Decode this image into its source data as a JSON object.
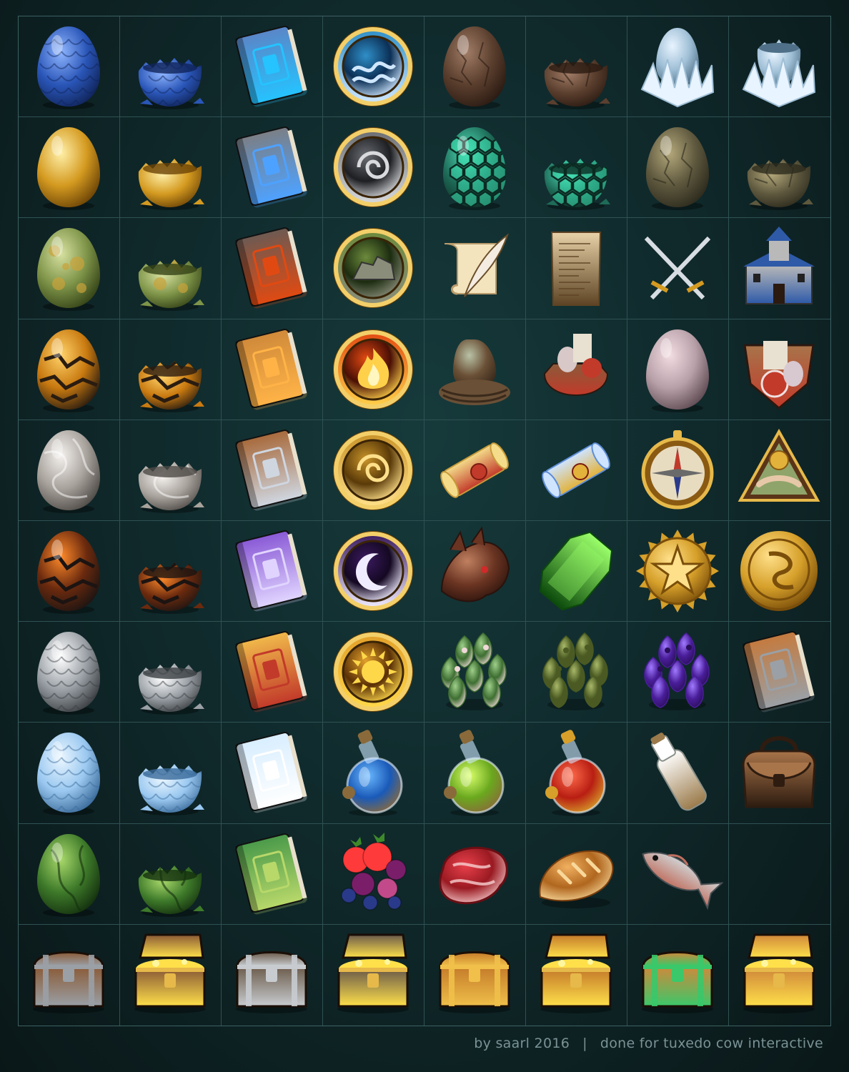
{
  "credit": {
    "author": "by saarl 2016",
    "separator": "|",
    "client": "done for tuxedo cow interactive"
  },
  "colors": {
    "background": "#102a2c",
    "grid_line": "#2f5153",
    "credit_text": "#7a9395"
  },
  "grid": {
    "columns": 8,
    "rows": 10,
    "icons": [
      {
        "icon": "egg",
        "c1": "#8fb6ff",
        "c2": "#2a56b8",
        "c3": "#10245a",
        "mark": "scale"
      },
      {
        "icon": "egg-hatched",
        "c1": "#8fb6ff",
        "c2": "#2a56b8",
        "c3": "#10245a",
        "mark": "scale"
      },
      {
        "icon": "book",
        "c1": "#5a86c8",
        "c2": "#243f78",
        "c3": "#25c3ff"
      },
      {
        "icon": "medallion",
        "c1": "#2f8fc8",
        "c2": "#0b2f55",
        "c3": "#cfe7ff",
        "sym": "wave"
      },
      {
        "icon": "egg",
        "c1": "#a07c66",
        "c2": "#5b3f2e",
        "c3": "#2a1a12",
        "mark": "crack"
      },
      {
        "icon": "egg-hatched",
        "c1": "#a07c66",
        "c2": "#5b3f2e",
        "c3": "#2a1a12",
        "mark": "crack"
      },
      {
        "icon": "egg-crystal",
        "c1": "#e8f4ff",
        "c2": "#9fbfd6",
        "c3": "#4f7088"
      },
      {
        "icon": "egg-crystal-hatched",
        "c1": "#e8f4ff",
        "c2": "#9fbfd6",
        "c3": "#4f7088"
      },
      {
        "icon": "egg",
        "c1": "#fff0a8",
        "c2": "#d49a20",
        "c3": "#6b4306",
        "mark": "none"
      },
      {
        "icon": "egg-hatched",
        "c1": "#fff0a8",
        "c2": "#d49a20",
        "c3": "#6b4306",
        "mark": "none"
      },
      {
        "icon": "book",
        "c1": "#7b7f86",
        "c2": "#35383d",
        "c3": "#4ea2ff"
      },
      {
        "icon": "medallion",
        "c1": "#6a6d72",
        "c2": "#1d1f23",
        "c3": "#d8dadd",
        "sym": "swirl"
      },
      {
        "icon": "egg",
        "c1": "#4fe0b8",
        "c2": "#1e6b58",
        "c3": "#0b2a22",
        "mark": "hex"
      },
      {
        "icon": "egg-hatched",
        "c1": "#4fe0b8",
        "c2": "#1e6b58",
        "c3": "#0b2a22",
        "mark": "hex"
      },
      {
        "icon": "egg",
        "c1": "#b3a77a",
        "c2": "#5e583e",
        "c3": "#2c2a1d",
        "mark": "crack"
      },
      {
        "icon": "egg-hatched",
        "c1": "#b3a77a",
        "c2": "#5e583e",
        "c3": "#2c2a1d",
        "mark": "crack"
      },
      {
        "icon": "egg",
        "c1": "#d7e1a0",
        "c2": "#7e9448",
        "c3": "#344217",
        "mark": "spot"
      },
      {
        "icon": "egg-hatched",
        "c1": "#d7e1a0",
        "c2": "#7e9448",
        "c3": "#344217",
        "mark": "spot"
      },
      {
        "icon": "book",
        "c1": "#6d5a52",
        "c2": "#2e2420",
        "c3": "#e04a12"
      },
      {
        "icon": "medallion",
        "c1": "#6c8a3c",
        "c2": "#1c2c10",
        "c3": "#8a8d7a",
        "sym": "rock"
      },
      {
        "icon": "scroll-quill",
        "c1": "#f3e4be",
        "c2": "#b89a6a",
        "c3": "#6b4e2a"
      },
      {
        "icon": "parchment",
        "c1": "#e8d2a8",
        "c2": "#a68454",
        "c3": "#5e4424"
      },
      {
        "icon": "swords",
        "c1": "#d7dde2",
        "c2": "#7c8590",
        "c3": "#d49a20"
      },
      {
        "icon": "castle",
        "c1": "#b9b9b9",
        "c2": "#5a5a62",
        "c3": "#2e5aa8"
      },
      {
        "icon": "egg",
        "c1": "#ffd36a",
        "c2": "#c97a10",
        "c3": "#2a1c10",
        "mark": "lava"
      },
      {
        "icon": "egg-hatched",
        "c1": "#ffd36a",
        "c2": "#c97a10",
        "c3": "#2a1c10",
        "mark": "lava"
      },
      {
        "icon": "book",
        "c1": "#d08a3a",
        "c2": "#6e3b12",
        "c3": "#ffb347"
      },
      {
        "icon": "medallion",
        "c1": "#e24a12",
        "c2": "#4a0f05",
        "c3": "#ffd14a",
        "sym": "fire"
      },
      {
        "icon": "nest",
        "c1": "#b9c2a6",
        "c2": "#6a5036",
        "c3": "#3a2a1c"
      },
      {
        "icon": "sack",
        "c1": "#8a5a3a",
        "c2": "#4a2c1a",
        "c3": "#c23a2a"
      },
      {
        "icon": "egg",
        "c1": "#f2dde2",
        "c2": "#b8a0a8",
        "c3": "#5e4a52",
        "mark": "none"
      },
      {
        "icon": "shield-badge",
        "c1": "#a8744a",
        "c2": "#5a3a22",
        "c3": "#c23a2a"
      },
      {
        "icon": "egg",
        "c1": "#f4f1ee",
        "c2": "#a8a29c",
        "c3": "#4e4a46",
        "mark": "swirl"
      },
      {
        "icon": "egg-hatched",
        "c1": "#f4f1ee",
        "c2": "#a8a29c",
        "c3": "#4e4a46",
        "mark": "swirl"
      },
      {
        "icon": "book",
        "c1": "#a86a3c",
        "c2": "#4e2c16",
        "c3": "#cfd6e0"
      },
      {
        "icon": "medallion",
        "c1": "#c9942a",
        "c2": "#5a3a08",
        "c3": "#ffe08a",
        "sym": "swirl"
      },
      {
        "icon": "diploma",
        "c1": "#f4dc8a",
        "c2": "#c69a3a",
        "c3": "#c23a2a"
      },
      {
        "icon": "diploma",
        "c1": "#cfe4ff",
        "c2": "#5e8ed6",
        "c3": "#e2b23a"
      },
      {
        "icon": "compass",
        "c1": "#e8dcc0",
        "c2": "#9a7430",
        "c3": "#c23a2a"
      },
      {
        "icon": "triangle-badge",
        "c1": "#8fa46a",
        "c2": "#6a4428",
        "c3": "#e2b23a"
      },
      {
        "icon": "egg",
        "c1": "#ff8a2a",
        "c2": "#6b2a0e",
        "c3": "#1c1412",
        "mark": "lava"
      },
      {
        "icon": "egg-hatched",
        "c1": "#ff8a2a",
        "c2": "#6b2a0e",
        "c3": "#1c1412",
        "mark": "lava"
      },
      {
        "icon": "book",
        "c1": "#8a5ad6",
        "c2": "#3a1e6e",
        "c3": "#e0d4ff"
      },
      {
        "icon": "medallion",
        "c1": "#3a1a5e",
        "c2": "#140822",
        "c3": "#f0ecff",
        "sym": "moon"
      },
      {
        "icon": "dragon-head",
        "c1": "#c08060",
        "c2": "#6a3422",
        "c3": "#2a120c"
      },
      {
        "icon": "gem",
        "c1": "#9bff6a",
        "c2": "#22a81e",
        "c3": "#0c4a0c"
      },
      {
        "icon": "medal-star",
        "c1": "#ffe08a",
        "c2": "#d6a02a",
        "c3": "#7a4e0a"
      },
      {
        "icon": "coin",
        "c1": "#ffe08a",
        "c2": "#d6a02a",
        "c3": "#7a4e0a"
      },
      {
        "icon": "egg",
        "c1": "#ffffff",
        "c2": "#9aa0a6",
        "c3": "#3a3e42",
        "mark": "scale"
      },
      {
        "icon": "egg-hatched",
        "c1": "#ffffff",
        "c2": "#9aa0a6",
        "c3": "#3a3e42",
        "mark": "scale"
      },
      {
        "icon": "book",
        "c1": "#f0b84a",
        "c2": "#8a5a12",
        "c3": "#c23a2a"
      },
      {
        "icon": "medallion",
        "c1": "#e2a02a",
        "c2": "#5a3006",
        "c3": "#ffd84a",
        "sym": "sun"
      },
      {
        "icon": "herb",
        "c1": "#9fcf8a",
        "c2": "#3e6e32",
        "c3": "#f0d8d8"
      },
      {
        "icon": "herb",
        "c1": "#a8b868",
        "c2": "#4a5a22",
        "c3": "#4a5a22"
      },
      {
        "icon": "herb",
        "c1": "#a07aff",
        "c2": "#4a1e9a",
        "c3": "#2a0e5a"
      },
      {
        "icon": "book",
        "c1": "#c47a3e",
        "c2": "#6a3a16",
        "c3": "#9aa0a6"
      },
      {
        "icon": "egg",
        "c1": "#eaf6ff",
        "c2": "#9ac8f0",
        "c3": "#3a6a9a",
        "mark": "scale"
      },
      {
        "icon": "egg-hatched",
        "c1": "#eaf6ff",
        "c2": "#9ac8f0",
        "c3": "#3a6a9a",
        "mark": "scale"
      },
      {
        "icon": "book",
        "c1": "#d8eeff",
        "c2": "#7ab0da",
        "c3": "#ffffff"
      },
      {
        "icon": "potion",
        "c1": "#6ab8ff",
        "c2": "#1a5ab8",
        "c3": "#8a6a3a"
      },
      {
        "icon": "potion",
        "c1": "#d8ff6a",
        "c2": "#6aa81e",
        "c3": "#8a6a3a"
      },
      {
        "icon": "potion",
        "c1": "#ff6a4a",
        "c2": "#b81e12",
        "c3": "#d6a02a"
      },
      {
        "icon": "bottle",
        "c1": "#ffffff",
        "c2": "#c8ccc8",
        "c3": "#9a7a4a"
      },
      {
        "icon": "satchel",
        "c1": "#a8744a",
        "c2": "#5a3a22",
        "c3": "#2e1c10"
      },
      {
        "icon": "egg",
        "c1": "#a8d86a",
        "c2": "#3e7a2a",
        "c3": "#14300e",
        "mark": "vine"
      },
      {
        "icon": "egg-hatched",
        "c1": "#a8d86a",
        "c2": "#3e7a2a",
        "c3": "#14300e",
        "mark": "vine"
      },
      {
        "icon": "book",
        "c1": "#4a9a4a",
        "c2": "#1a4a1e",
        "c3": "#b8d86a"
      },
      {
        "icon": "berries",
        "c1": "#ff3a3a",
        "c2": "#7a1e6a",
        "c3": "#2a3a8a"
      },
      {
        "icon": "steak",
        "c1": "#e8404a",
        "c2": "#9a1a22",
        "c3": "#f8d0d0"
      },
      {
        "icon": "bread",
        "c1": "#f0b060",
        "c2": "#b0661e",
        "c3": "#f8d89a"
      },
      {
        "icon": "fish",
        "c1": "#d0d4d6",
        "c2": "#7a8084",
        "c3": "#c07060"
      },
      {
        "icon": "empty",
        "c1": "#000000",
        "c2": "#000000",
        "c3": "#000000"
      },
      {
        "icon": "chest",
        "c1": "#8a5a36",
        "c2": "#3a2412",
        "c3": "#9aa0a6"
      },
      {
        "icon": "chest-open",
        "c1": "#8a5a36",
        "c2": "#3a2412",
        "c3": "#ffe04a"
      },
      {
        "icon": "chest",
        "c1": "#6a5a4a",
        "c2": "#2a2420",
        "c3": "#c8ccd0"
      },
      {
        "icon": "chest-open",
        "c1": "#6a5a4a",
        "c2": "#2a2420",
        "c3": "#ffe04a"
      },
      {
        "icon": "chest",
        "c1": "#c47a2a",
        "c2": "#5a3010",
        "c3": "#f0c04a"
      },
      {
        "icon": "chest-open",
        "c1": "#c47a2a",
        "c2": "#5a3010",
        "c3": "#ffe04a"
      },
      {
        "icon": "chest",
        "c1": "#d0883a",
        "c2": "#6a3a12",
        "c3": "#3ac86a"
      },
      {
        "icon": "chest-open",
        "c1": "#d0883a",
        "c2": "#6a3a12",
        "c3": "#ffe04a"
      }
    ]
  }
}
